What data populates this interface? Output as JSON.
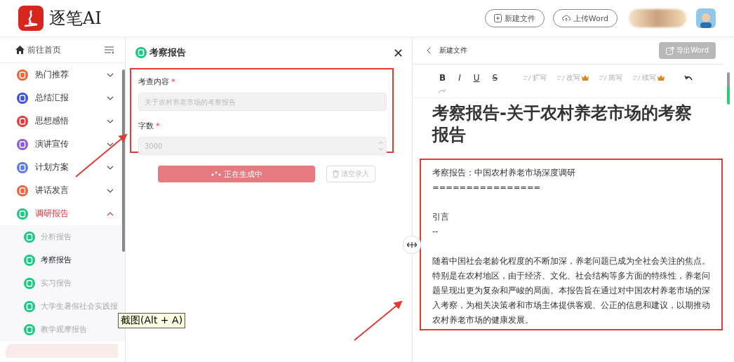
{
  "header": {
    "brand": "逐笔AI",
    "buttons": [
      {
        "label": "新建文件"
      },
      {
        "label": "上传Word"
      }
    ]
  },
  "sidebar": {
    "home": "前往首页",
    "groups": [
      {
        "label": "热门推荐",
        "color": "#f0643c",
        "expanded": false,
        "selected": false
      },
      {
        "label": "总结汇报",
        "color": "#3c50e0",
        "expanded": false,
        "selected": false
      },
      {
        "label": "思想感悟",
        "color": "#e8383d",
        "expanded": false,
        "selected": false
      },
      {
        "label": "演讲宣传",
        "color": "#8c5ae6",
        "expanded": false,
        "selected": false
      },
      {
        "label": "计划方案",
        "color": "#5a78e6",
        "expanded": false,
        "selected": false
      },
      {
        "label": "讲话发言",
        "color": "#f0643c",
        "expanded": false,
        "selected": false
      },
      {
        "label": "调研报告",
        "color": "#1ec882",
        "expanded": true,
        "selected": true,
        "children": [
          {
            "label": "分析报告",
            "selected": false
          },
          {
            "label": "考察报告",
            "selected": true
          },
          {
            "label": "实习报告",
            "selected": false
          },
          {
            "label": "大学生暑假社会实践报",
            "selected": false
          },
          {
            "label": "教学观摩报告",
            "selected": false
          }
        ]
      }
    ]
  },
  "form": {
    "title": "考察报告",
    "close": "✕",
    "fields": [
      {
        "label": "考查内容",
        "required_mark": "*",
        "kind": "text",
        "placeholder": "关于农村养老市场的考察报告"
      },
      {
        "label": "字数",
        "required_mark": "*",
        "kind": "number",
        "placeholder": "3000"
      }
    ],
    "generate_button": {
      "label": "正在生成中",
      "loading": true
    },
    "clear_button": {
      "label": "清空录入",
      "disabled": true
    }
  },
  "tooltip": "截图(Alt + A)",
  "editor": {
    "back_label": "新建文件",
    "export_button": {
      "label": "导出Word",
      "disabled": true
    },
    "format_tools": [
      "B",
      "I",
      "U",
      "S"
    ],
    "ai_tools": [
      {
        "label": "扩写",
        "premium": false
      },
      {
        "label": "改写",
        "premium": true
      },
      {
        "label": "简写",
        "premium": false
      },
      {
        "label": "续写",
        "premium": true
      }
    ],
    "doc_title": "考察报告-关于农村养老市场的考察报告",
    "sections": [
      [
        "考察报告：中国农村养老市场深度调研",
        "================"
      ],
      [
        "引言",
        "--"
      ],
      [
        "随着中国社会老龄化程度的不断加深，养老问题已成为全社会关注的焦点。特别是在农村地区，由于经济、文化、社会结构等多方面的特殊性，养老问题呈现出更为复杂和严峻的局面。本报告旨在通过对中国农村养老市场的深入考察，为相关决策者和市场主体提供客观、公正的信息和建议，以期推动农村养老市场的健康发展。"
      ]
    ]
  }
}
